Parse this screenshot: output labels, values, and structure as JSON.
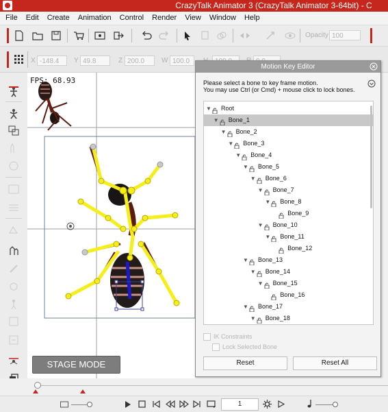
{
  "title": "CrazyTalk Animator 3  (CrazyTalk Animator 3-64bit) - C",
  "menu": [
    "File",
    "Edit",
    "Create",
    "Animation",
    "Control",
    "Render",
    "View",
    "Window",
    "Help"
  ],
  "toolbar": {
    "opacity_label": "Opacity",
    "opacity_value": "100"
  },
  "transform": {
    "x_label": "X",
    "x_value": "-148.4",
    "y_label": "Y",
    "y_value": "49.8",
    "z_label": "Z",
    "z_value": "200.0",
    "w_label": "W",
    "w_value": "100.0",
    "h_label": "H",
    "h_value": "100.0",
    "r_label": "R",
    "r_value": "0.0"
  },
  "stage": {
    "fps_text": "FPS: 68.93",
    "mode_button": "STAGE MODE"
  },
  "mke": {
    "title": "Motion Key Editor",
    "instruction_1": "Please select a bone to key frame motion.",
    "instruction_2": "You may use Ctrl (or Cmd) + mouse click to lock bones.",
    "tree": [
      {
        "label": "Root",
        "level": 0,
        "expanded": true,
        "selected": false
      },
      {
        "label": "Bone_1",
        "level": 1,
        "expanded": true,
        "selected": true
      },
      {
        "label": "Bone_2",
        "level": 2,
        "expanded": true,
        "selected": false
      },
      {
        "label": "Bone_3",
        "level": 3,
        "expanded": true,
        "selected": false
      },
      {
        "label": "Bone_4",
        "level": 4,
        "expanded": true,
        "selected": false
      },
      {
        "label": "Bone_5",
        "level": 5,
        "expanded": true,
        "selected": false
      },
      {
        "label": "Bone_6",
        "level": 6,
        "expanded": true,
        "selected": false
      },
      {
        "label": "Bone_7",
        "level": 7,
        "expanded": true,
        "selected": false
      },
      {
        "label": "Bone_8",
        "level": 8,
        "expanded": true,
        "selected": false
      },
      {
        "label": "Bone_9",
        "level": 9,
        "expanded": null,
        "selected": false
      },
      {
        "label": "Bone_10",
        "level": 7,
        "expanded": true,
        "selected": false
      },
      {
        "label": "Bone_11",
        "level": 8,
        "expanded": true,
        "selected": false
      },
      {
        "label": "Bone_12",
        "level": 9,
        "expanded": null,
        "selected": false
      },
      {
        "label": "Bone_13",
        "level": 5,
        "expanded": true,
        "selected": false
      },
      {
        "label": "Bone_14",
        "level": 6,
        "expanded": true,
        "selected": false
      },
      {
        "label": "Bone_15",
        "level": 7,
        "expanded": true,
        "selected": false
      },
      {
        "label": "Bone_16",
        "level": 8,
        "expanded": null,
        "selected": false
      },
      {
        "label": "Bone_17",
        "level": 5,
        "expanded": true,
        "selected": false
      },
      {
        "label": "Bone_18",
        "level": 6,
        "expanded": true,
        "selected": false
      }
    ],
    "ik_constraints": "IK Constraints",
    "lock_selected_bone": "Lock Selected Bone",
    "reset_button": "Reset",
    "reset_all_button": "Reset All"
  },
  "playback": {
    "frame_value": "1"
  },
  "colors": {
    "brand_red": "#c5271c",
    "bone_yellow": "#f5ee1a",
    "selection_blue": "#1a1acc"
  },
  "icons": [
    "new-file-icon",
    "open-folder-icon",
    "save-icon",
    "cart-icon",
    "preview-icon",
    "export-icon",
    "undo-icon",
    "redo-icon",
    "select-arrow-icon",
    "copy-icon",
    "paste-icon",
    "flip-icon",
    "transform-icon",
    "visibility-icon"
  ]
}
